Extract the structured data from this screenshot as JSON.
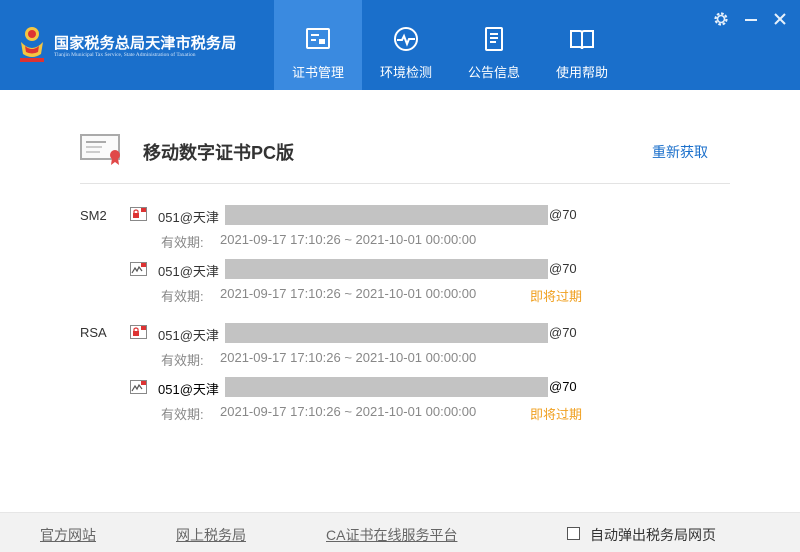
{
  "header": {
    "brand_title": "国家税务总局天津市税务局",
    "brand_subtitle": "Tianjin Municipal Tax Service, State Administration of Taxation",
    "colors": {
      "bar": "#1a6fcb",
      "active_tab": "#3a8ae0"
    },
    "tabs": [
      {
        "label": "证书管理",
        "icon": "certificate-card-icon",
        "active": true
      },
      {
        "label": "环境检测",
        "icon": "pulse-gauge-icon",
        "active": false
      },
      {
        "label": "公告信息",
        "icon": "document-icon",
        "active": false
      },
      {
        "label": "使用帮助",
        "icon": "open-book-icon",
        "active": false
      }
    ],
    "window_controls": [
      "gear-icon",
      "minimize-icon",
      "close-icon"
    ]
  },
  "main": {
    "title": "移动数字证书PC版",
    "refresh_label": "重新获取",
    "valid_label": "有效期:",
    "groups": [
      {
        "algorithm": "SM2",
        "certs": [
          {
            "icon": "cert-lock-icon",
            "name_prefix": "051@天津",
            "name_suffix": "@70",
            "valid_range": "2021-09-17 17:10:26 ~ 2021-10-01 00:00:00",
            "status": ""
          },
          {
            "icon": "cert-signature-icon",
            "name_prefix": "051@天津",
            "name_suffix": "@70",
            "valid_range": "2021-09-17 17:10:26 ~ 2021-10-01 00:00:00",
            "status": "即将过期"
          }
        ]
      },
      {
        "algorithm": "RSA",
        "certs": [
          {
            "icon": "cert-lock-icon",
            "name_prefix": "051@天津",
            "name_suffix": "@70",
            "valid_range": "2021-09-17 17:10:26 ~ 2021-10-01 00:00:00",
            "status": ""
          },
          {
            "icon": "cert-signature-icon",
            "name_prefix": "051@天津",
            "name_suffix": "@70",
            "valid_range": "2021-09-17 17:10:26 ~ 2021-10-01 00:00:00",
            "status": "即将过期"
          }
        ]
      }
    ]
  },
  "footer": {
    "links": [
      "官方网站",
      "网上税务局",
      "CA证书在线服务平台"
    ],
    "checkbox_label": "自动弹出税务局网页",
    "checkbox_checked": false
  }
}
